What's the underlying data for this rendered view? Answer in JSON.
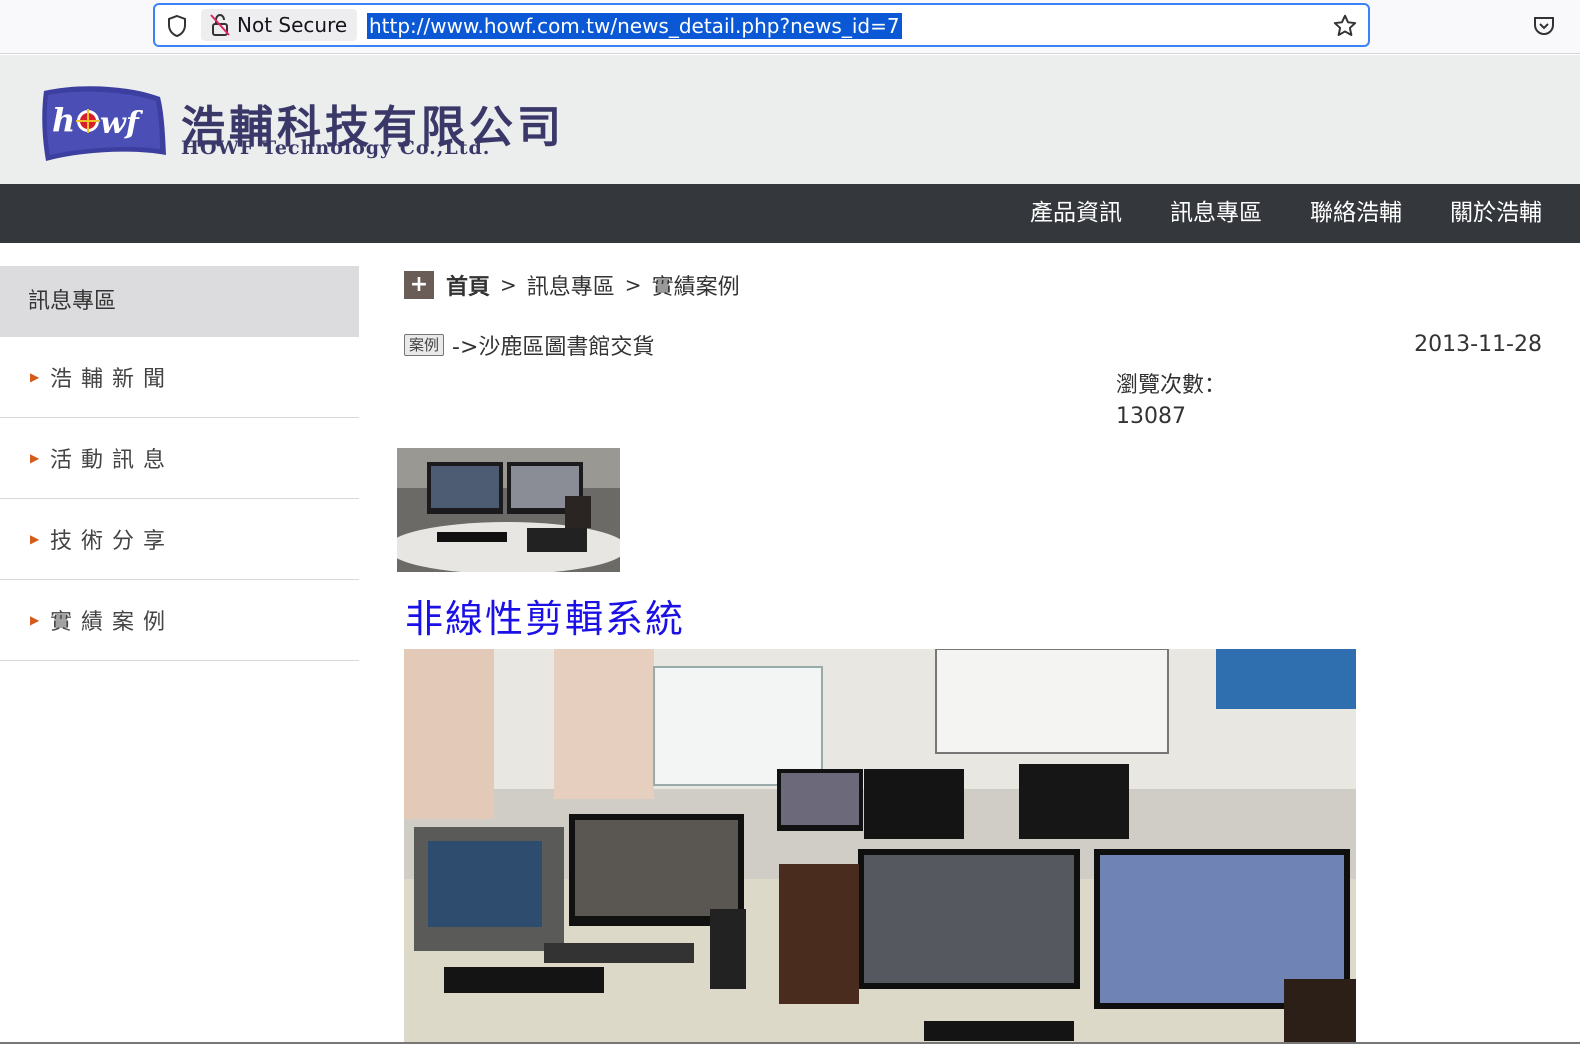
{
  "browser": {
    "security_label": "Not Secure",
    "url": "http://www.howf.com.tw/news_detail.php?news_id=7"
  },
  "header": {
    "logo_text": "howf",
    "brand_cn": "浩輔科技有限公司",
    "brand_en": "HOWF Technology Co.,Ltd."
  },
  "nav": {
    "items": [
      "產品資訊",
      "訊息專區",
      "聯絡浩輔",
      "關於浩輔"
    ]
  },
  "sidebar": {
    "title": "訊息專區",
    "items": [
      "浩輔新聞",
      "活動訊息",
      "技術分享",
      "實績案例"
    ]
  },
  "breadcrumb": {
    "home": "首頁",
    "sep": ">",
    "section": "訊息專區",
    "current": "實績案例"
  },
  "news": {
    "tag": "案例",
    "title": "->沙鹿區圖書館交貨",
    "date": "2013-11-28",
    "views_label": "瀏覽次數：",
    "views_count": "13087",
    "heading": "非線性剪輯系統"
  },
  "colors": {
    "nav_bg": "#34373c",
    "header_bg": "#eceded",
    "heading_blue": "#1b11e6",
    "arrow_orange": "#d45b1c",
    "url_highlight": "#0a58d6"
  }
}
